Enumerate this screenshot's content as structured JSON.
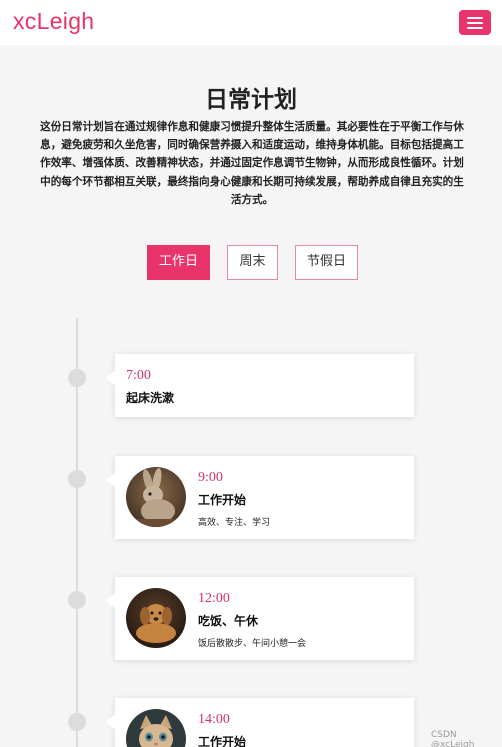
{
  "navbar": {
    "brand": "xcLeigh",
    "menu_icon": "hamburger-icon",
    "accent": "#e8336b"
  },
  "header": {
    "title": "日常计划",
    "intro": "这份日常计划旨在通过规律作息和健康习惯提升整体生活质量。其必要性在于平衡工作与休息，避免疲劳和久坐危害，同时确保营养摄入和适度运动，维持身体机能。目标包括提高工作效率、增强体质、改善精神状态，并通过固定作息调节生物钟，从而形成良性循环。计划中的每个环节都相互关联，最终指向身心健康和长期可持续发展，帮助养成自律且充实的生活方式。"
  },
  "tabs": [
    {
      "label": "工作日",
      "active": true
    },
    {
      "label": "周末",
      "active": false
    },
    {
      "label": "节假日",
      "active": false
    }
  ],
  "timeline": [
    {
      "time": "7:00",
      "title": "起床洗漱",
      "desc": "",
      "image": ""
    },
    {
      "time": "9:00",
      "title": "工作开始",
      "desc": "高效、专注、学习",
      "image": "rabbit-photo"
    },
    {
      "time": "12:00",
      "title": "吃饭、午休",
      "desc": "饭后散散步、午间小憩一会",
      "image": "puppy-photo"
    },
    {
      "time": "14:00",
      "title": "工作开始",
      "desc": "",
      "image": "kitten-photo"
    }
  ],
  "watermark": "CSDN @xcLeigh"
}
